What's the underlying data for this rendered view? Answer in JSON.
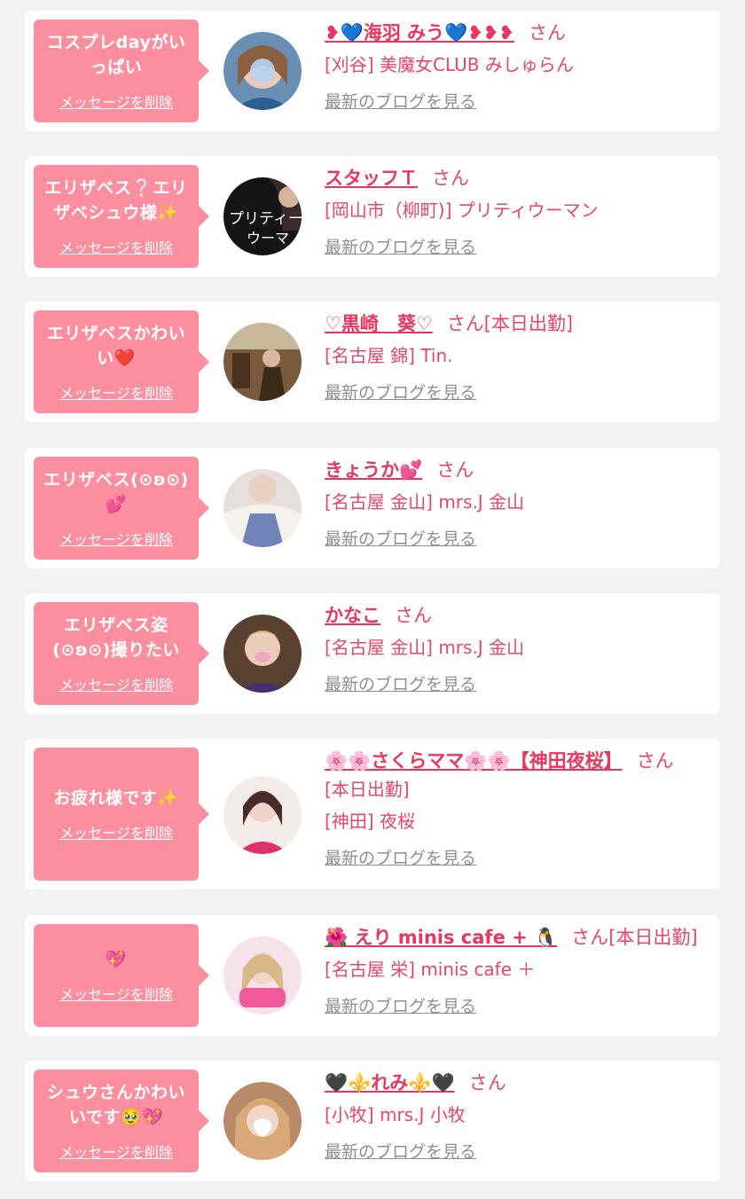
{
  "cards": [
    {
      "message": "コスプレdayがい\nっぱい",
      "delete_label": "メッセージを削除",
      "name": "❥💙海羽 みう💙❥❥❥",
      "honorific": "さん",
      "extra": "",
      "shop": "[刈谷] 美魔女CLUB みしゅらん",
      "blog_label": "最新のブログを見る",
      "avatar_icon": "photo-avatar"
    },
    {
      "message": "エリザベス❔エリ\nザベシュウ様✨",
      "delete_label": "メッセージを削除",
      "name": "スタッフＴ",
      "honorific": "さん",
      "extra": "",
      "shop": "[岡山市（柳町)] プリティウーマン",
      "blog_label": "最新のブログを見る",
      "avatar_icon": "shop-logo-avatar",
      "avatar_text": "プリティー"
    },
    {
      "message": "エリザベスかわい\nい❤️",
      "delete_label": "メッセージを削除",
      "name": "♡黒崎　葵♡",
      "honorific": "さん",
      "extra": "[本日出勤]",
      "shop": "[名古屋 錦] Tin.",
      "blog_label": "最新のブログを見る",
      "avatar_icon": "photo-avatar"
    },
    {
      "message": "エリザベス(⊙ʚ⊙)\n💕",
      "delete_label": "メッセージを削除",
      "name": "きょうか💕",
      "honorific": "さん",
      "extra": "",
      "shop": "[名古屋 金山] mrs.J 金山",
      "blog_label": "最新のブログを見る",
      "avatar_icon": "photo-avatar"
    },
    {
      "message": "エリザベス姿\n(⊙ʚ⊙)撮りたい",
      "delete_label": "メッセージを削除",
      "name": "かなこ",
      "honorific": "さん",
      "extra": "",
      "shop": "[名古屋 金山] mrs.J 金山",
      "blog_label": "最新のブログを見る",
      "avatar_icon": "photo-avatar"
    },
    {
      "message": "お疲れ様です✨",
      "delete_label": "メッセージを削除",
      "name": "🌸🌸さくらママ🌸🌸【神田夜桜】",
      "honorific": "さん",
      "extra": "",
      "status_line": "[本日出勤]",
      "shop": "[神田] 夜桜",
      "blog_label": "最新のブログを見る",
      "avatar_icon": "photo-avatar"
    },
    {
      "message": "💖",
      "delete_label": "メッセージを削除",
      "name": "🌺 えり minis cafe + 🐧",
      "honorific": "さん",
      "extra": "[本日出勤]",
      "shop": "[名古屋 栄] minis cafe ＋",
      "blog_label": "最新のブログを見る",
      "avatar_icon": "photo-avatar"
    },
    {
      "message": "シュウさんかわい\nいです🥹💖",
      "delete_label": "メッセージを削除",
      "name": "🖤⚜️れみ⚜️🖤",
      "honorific": "さん",
      "extra": "",
      "shop": "[小牧] mrs.J 小牧",
      "blog_label": "最新のブログを見る",
      "avatar_icon": "photo-avatar"
    }
  ],
  "colors": {
    "page_bg": "#f2f2f2",
    "card_bg": "#ffffff",
    "bubble": "#fb8fa0",
    "name": "#e8365f",
    "text": "#e8456b",
    "blog_link": "#8f8f8f"
  }
}
